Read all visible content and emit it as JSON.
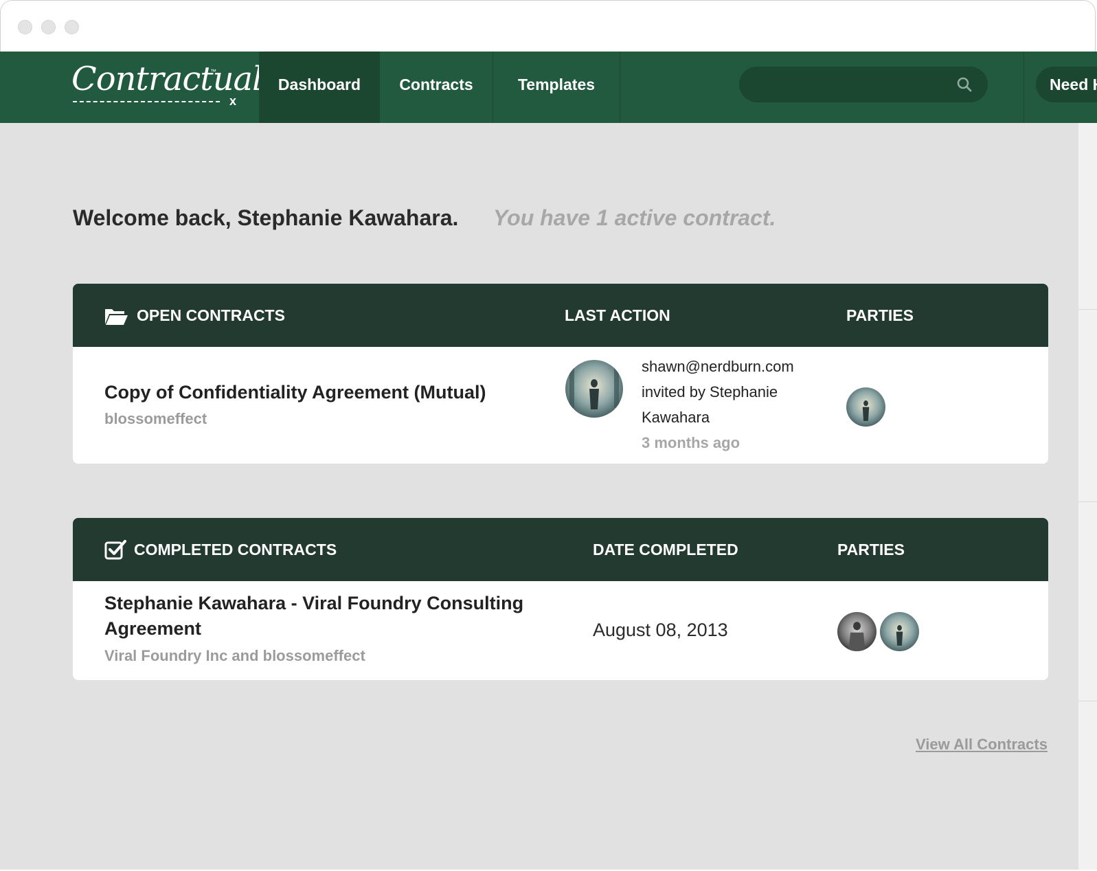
{
  "window": {
    "controls": [
      "close",
      "minimize",
      "zoom"
    ]
  },
  "nav": {
    "logo_text": "Contractually",
    "logo_tm": "™",
    "logo_x": "x",
    "tabs": [
      {
        "label": "Dashboard",
        "active": true
      },
      {
        "label": "Contracts",
        "active": false
      },
      {
        "label": "Templates",
        "active": false
      }
    ],
    "search": {
      "placeholder": "",
      "icon": "search-icon"
    },
    "help_label": "Need H"
  },
  "welcome": {
    "greeting": "Welcome back, Stephanie Kawahara.",
    "active_note": "You have 1 active contract."
  },
  "open_contracts": {
    "icon": "folder-open-icon",
    "headers": {
      "title": "OPEN CONTRACTS",
      "last_action": "LAST ACTION",
      "parties": "PARTIES"
    },
    "rows": [
      {
        "title": "Copy of Confidentiality Agreement (Mutual)",
        "subtitle": "blossomeffect",
        "last_action": {
          "line1": "shawn@nerdburn.com",
          "line2": "invited by Stephanie",
          "line3": "Kawahara",
          "time": "3 months ago"
        },
        "parties_count": 1
      }
    ]
  },
  "completed_contracts": {
    "icon": "checkbox-checked-icon",
    "headers": {
      "title": "COMPLETED CONTRACTS",
      "date": "DATE COMPLETED",
      "parties": "PARTIES"
    },
    "rows": [
      {
        "title_line1": "Stephanie Kawahara - Viral Foundry Consulting",
        "title_line2": "Agreement",
        "subtitle": "Viral Foundry Inc and blossomeffect",
        "date": "August 08, 2013",
        "parties_count": 2
      }
    ]
  },
  "footer": {
    "view_all": "View All Contracts"
  },
  "colors": {
    "nav_green": "#215a3e",
    "nav_active": "#1b4731",
    "panel_header": "#223a30",
    "content_bg": "#e1e1e1"
  }
}
